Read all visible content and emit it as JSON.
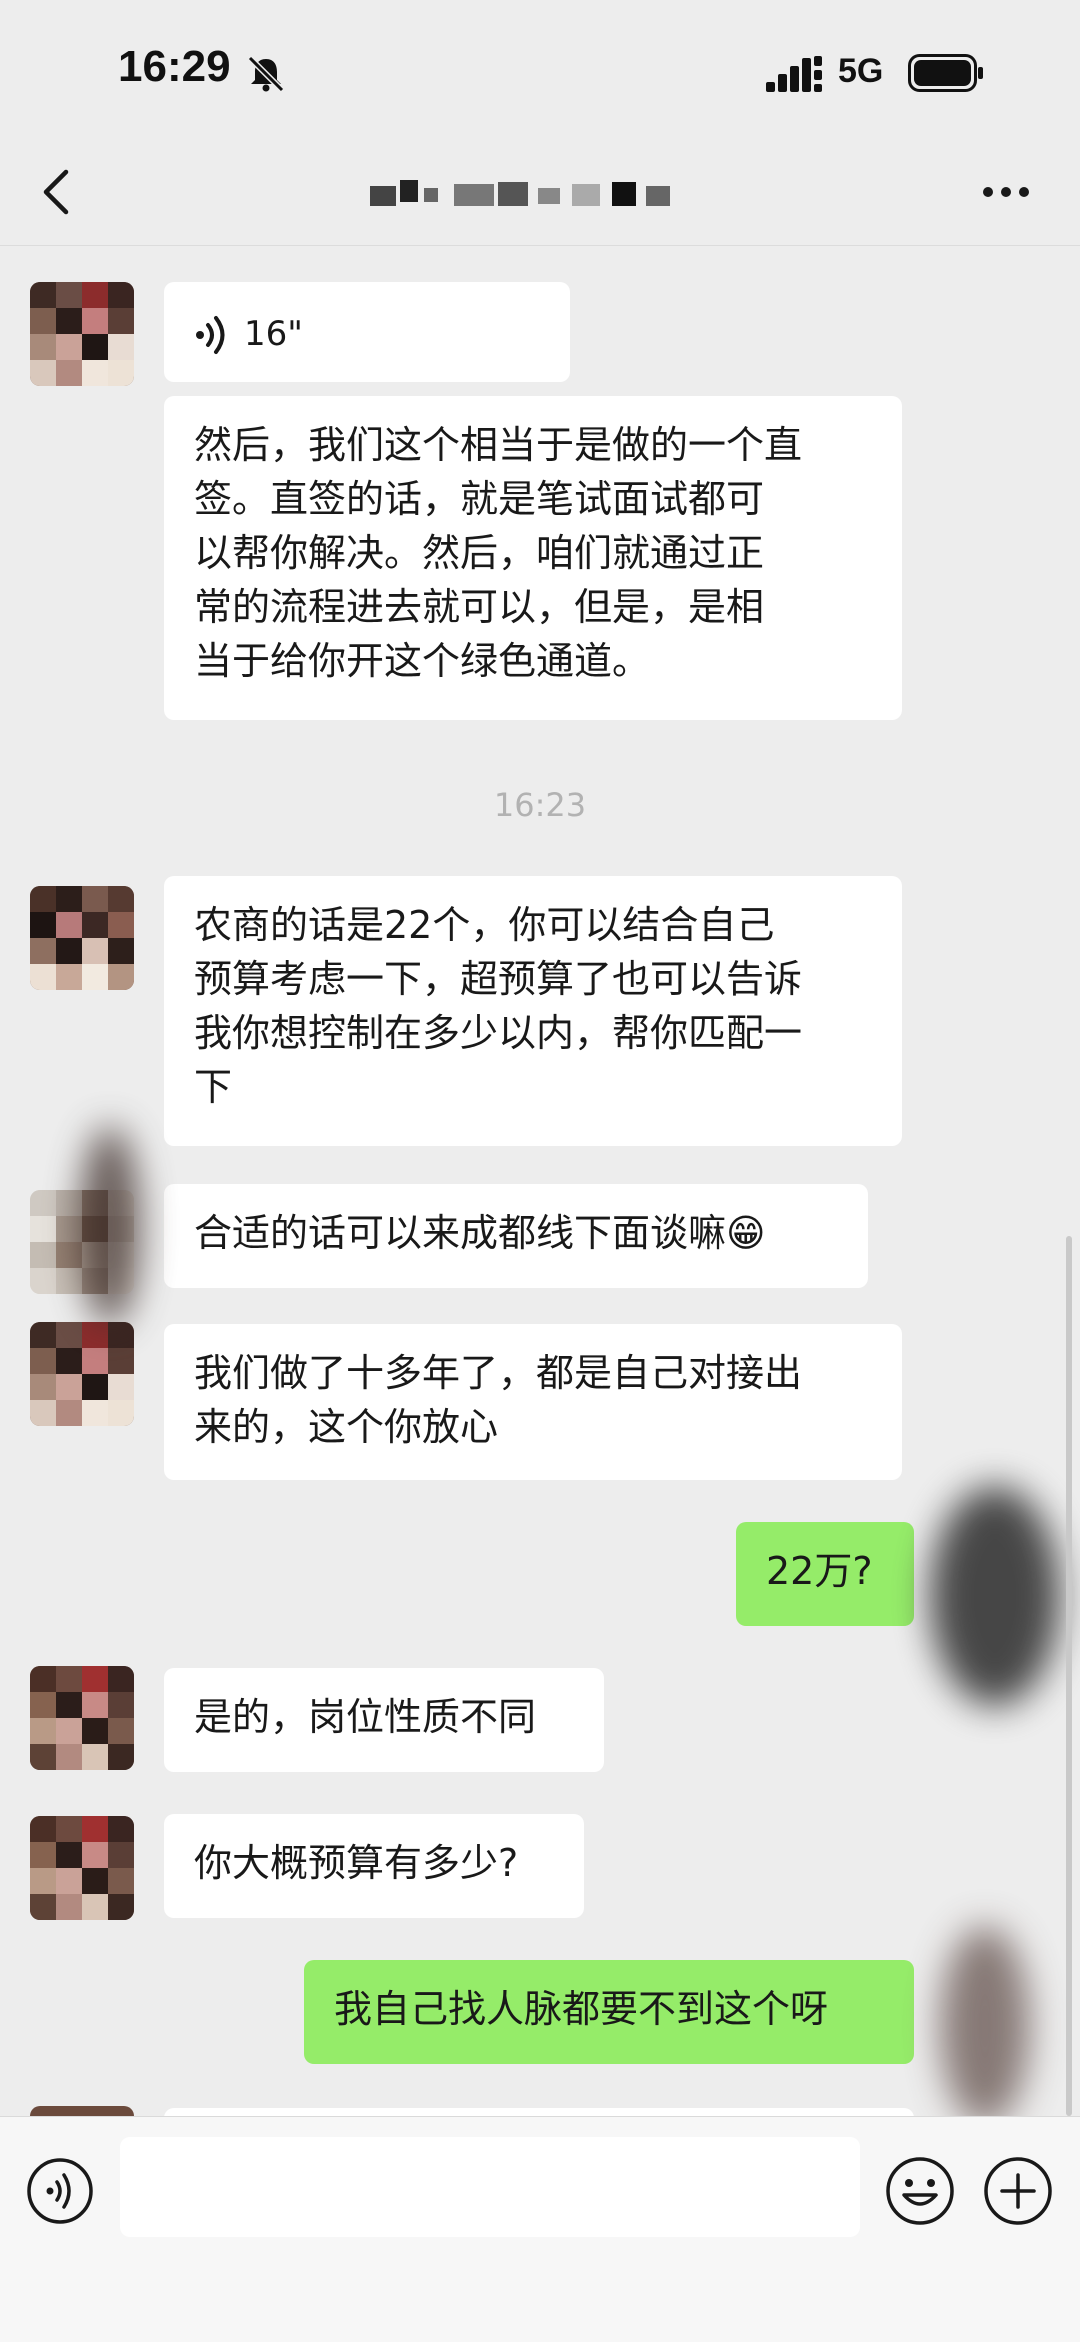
{
  "status_bar": {
    "time": "16:29",
    "network": "5G",
    "icons": [
      "bell-muted-icon",
      "signal-icon",
      "battery-icon"
    ]
  },
  "nav": {
    "title": "",
    "icons": [
      "back-icon",
      "more-icon"
    ]
  },
  "messages": [
    {
      "id": "m1",
      "side": "left",
      "type": "voice",
      "duration": "16\""
    },
    {
      "id": "m2",
      "side": "left",
      "type": "text",
      "lines": [
        "然后，我们这个相当于是做的一个直",
        "签。直签的话，就是笔试面试都可",
        "以帮你解决。然后，咱们就通过正",
        "常的流程进去就可以，但是，是相",
        "当于给你开这个绿色通道。"
      ]
    },
    {
      "id": "t1",
      "type": "timestamp",
      "text": "16:23"
    },
    {
      "id": "m3",
      "side": "left",
      "type": "text",
      "lines": [
        "农商的话是22个，你可以结合自己",
        "预算考虑一下，超预算了也可以告诉",
        "我你想控制在多少以内，帮你匹配一",
        "下"
      ]
    },
    {
      "id": "m4",
      "side": "left",
      "type": "text",
      "lines": [
        "合适的话可以来成都线下面谈嘛😁"
      ]
    },
    {
      "id": "m5",
      "side": "left",
      "type": "text",
      "lines": [
        "我们做了十多年了，都是自己对接出",
        "来的，这个你放心"
      ]
    },
    {
      "id": "m6",
      "side": "right",
      "type": "text",
      "lines": [
        "22万?"
      ]
    },
    {
      "id": "m7",
      "side": "left",
      "type": "text",
      "lines": [
        "是的，岗位性质不同"
      ]
    },
    {
      "id": "m8",
      "side": "left",
      "type": "text",
      "lines": [
        "你大概预算有多少?"
      ]
    },
    {
      "id": "m9",
      "side": "right",
      "type": "text",
      "lines": [
        "我自己找人脉都要不到这个呀"
      ]
    }
  ],
  "input_bar": {
    "placeholder": "",
    "icons": [
      "voice-input-icon",
      "emoji-icon",
      "plus-icon"
    ]
  },
  "colors": {
    "background": "#ededed",
    "bubble_incoming": "#ffffff",
    "bubble_outgoing": "#95ec69",
    "timestamp": "#b2b2b2"
  }
}
